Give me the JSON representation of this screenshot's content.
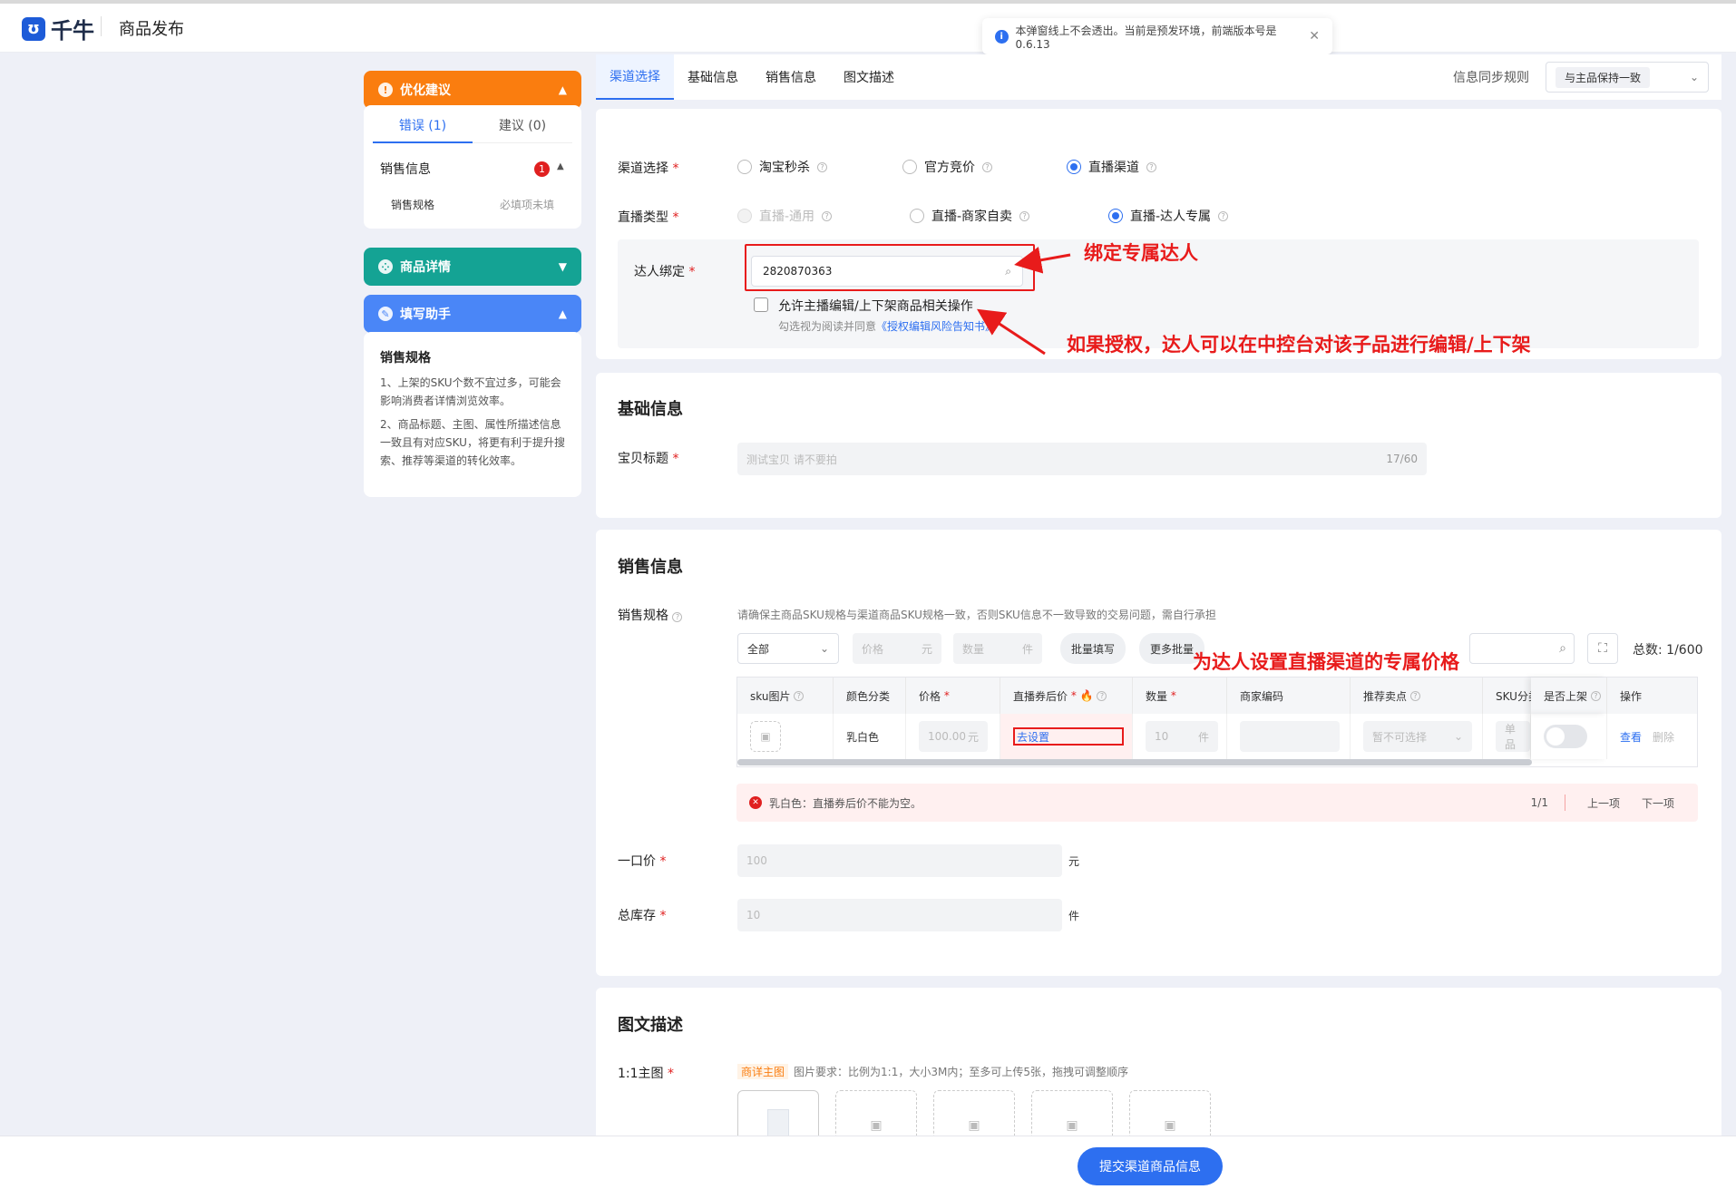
{
  "header": {
    "logo_text": "千牛",
    "page_title": "商品发布"
  },
  "toast": {
    "text": "本弹窗线上不会透出。当前是预发环境，前端版本号是0.6.13",
    "close": "✕"
  },
  "sidebar": {
    "optimize": {
      "title": "优化建议",
      "tabs": [
        "错误 (1)",
        "建议 (0)"
      ],
      "group": "销售信息",
      "badge": "1",
      "item_label": "销售规格",
      "item_status": "必填项未填"
    },
    "detail": {
      "title": "商品详情"
    },
    "helper": {
      "title": "填写助手",
      "heading": "销售规格",
      "tips": [
        "1、上架的SKU个数不宜过多，可能会影响消费者详情浏览效率。",
        "2、商品标题、主图、属性所描述信息一致且有对应SKU，将更有利于提升搜索、推荐等渠道的转化效率。"
      ]
    }
  },
  "nav": {
    "tabs": [
      "渠道选择",
      "基础信息",
      "销售信息",
      "图文描述"
    ],
    "sync_label": "信息同步规则",
    "sync_value": "与主品保持一致"
  },
  "channel": {
    "channel_label": "渠道选择",
    "channel_options": [
      "淘宝秒杀",
      "官方竞价",
      "直播渠道"
    ],
    "live_type_label": "直播类型",
    "live_type_options": [
      "直播-通用",
      "直播-商家自卖",
      "直播-达人专属"
    ],
    "talent_label": "达人绑定",
    "talent_value": "2820870363",
    "allow_label": "允许主播编辑/上下架商品相关操作",
    "agree_prefix": "勾选视为阅读并同意",
    "agree_link": "《授权编辑风险告知书》"
  },
  "annotations": {
    "bind": "绑定专属达人",
    "auth": "如果授权，达人可以在中控台对该子品进行编辑/上下架",
    "price": "为达人设置直播渠道的专属价格"
  },
  "basic": {
    "title": "基础信息",
    "title_label": "宝贝标题",
    "title_value": "测试宝贝 请不要拍",
    "counter": "17/60"
  },
  "sales": {
    "title": "销售信息",
    "spec_label": "销售规格",
    "spec_hint": "请确保主商品SKU规格与渠道商品SKU规格一致，否则SKU信息不一致导致的交易问题，需自行承担",
    "filter_all": "全部",
    "price_ph": "价格",
    "price_unit": "元",
    "qty_ph": "数量",
    "qty_unit": "件",
    "batch_fill": "批量填写",
    "more_batch": "更多批量",
    "total": "总数: 1/600",
    "columns": [
      "sku图片",
      "颜色分类",
      "价格",
      "直播券后价",
      "数量",
      "商家编码",
      "推荐卖点",
      "SKU分类",
      "是否上架",
      "操作"
    ],
    "row": {
      "color": "乳白色",
      "price": "100.00",
      "price_unit": "元",
      "coupon_link": "去设置",
      "qty": "10",
      "qty_unit": "件",
      "selling_point": "暂不可选择",
      "sku_type": "单品",
      "view": "查看",
      "delete": "删除"
    },
    "error_text": "乳白色：直播券后价不能为空。",
    "error_page": "1/1",
    "prev": "上一项",
    "next": "下一项",
    "fixed_price_label": "一口价",
    "fixed_price_value": "100",
    "fixed_price_unit": "元",
    "stock_label": "总库存",
    "stock_value": "10",
    "stock_unit": "件"
  },
  "desc": {
    "title": "图文描述",
    "main_img_label": "1:1主图",
    "tag": "商详主图",
    "hint": "图片要求：比例为1:1，大小3M内；至多可上传5张，拖拽可调整顺序"
  },
  "footer": {
    "submit": "提交渠道商品信息"
  },
  "colors": {
    "accent": "#2d6ff0",
    "orange": "#fa7d0f",
    "teal": "#14a394",
    "blue_panel": "#4a86f7",
    "error": "#e02020"
  }
}
